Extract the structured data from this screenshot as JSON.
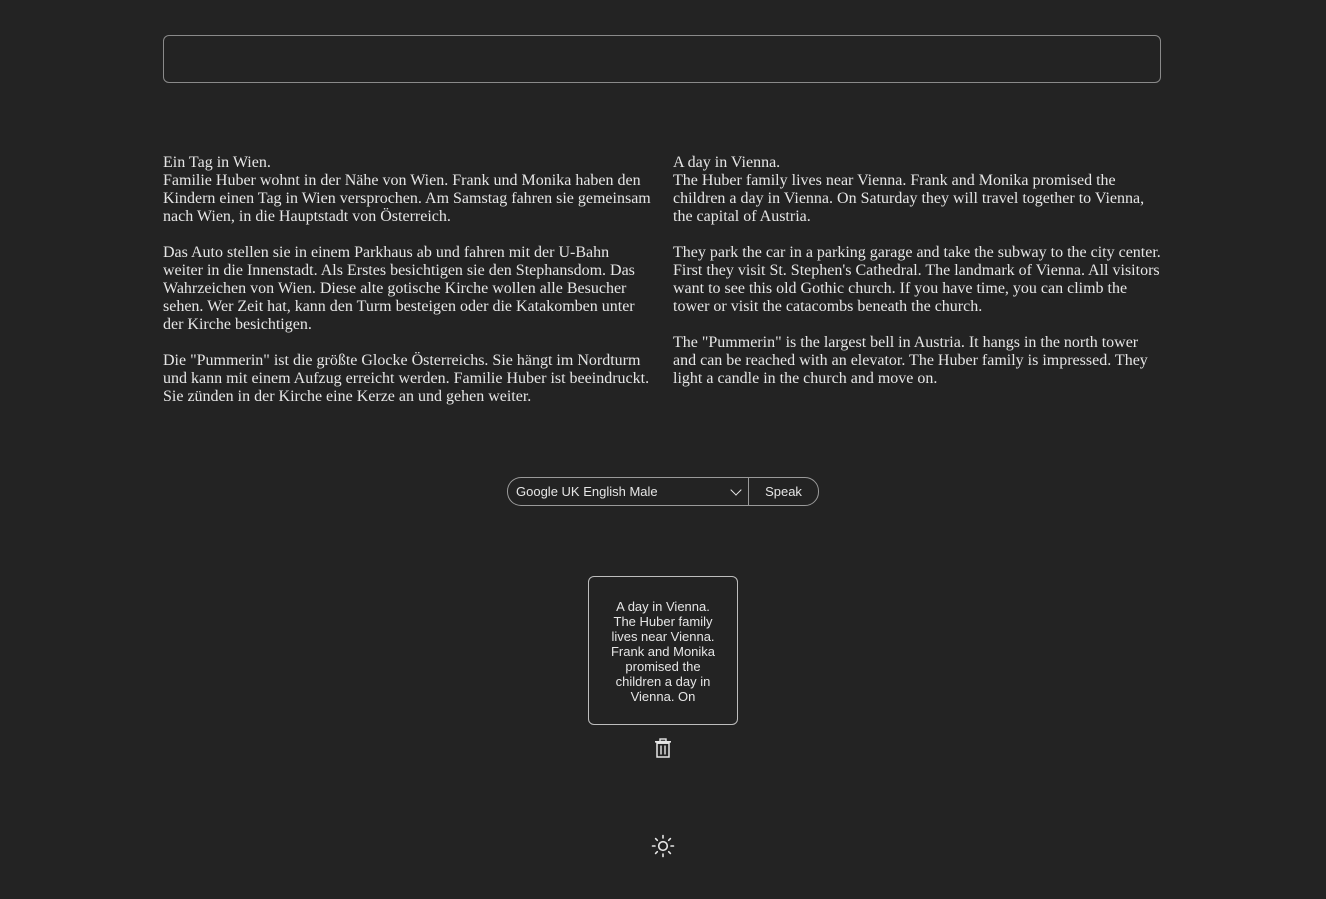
{
  "search": {
    "placeholder": "",
    "value": ""
  },
  "german": {
    "title": "Ein Tag in Wien.",
    "paragraphs": [
      "Familie Huber wohnt in der Nähe von Wien. Frank und Monika haben den Kindern einen Tag in Wien versprochen. Am Samstag fahren sie gemeinsam nach Wien, in die Hauptstadt von Österreich.",
      "Das Auto stellen sie in einem Parkhaus ab und fahren mit der U-Bahn weiter in die Innenstadt. Als Erstes besichtigen sie den Stephansdom. Das Wahrzeichen von Wien. Diese alte gotische Kirche wollen alle Besucher sehen. Wer Zeit hat, kann den Turm besteigen oder die Katakomben unter der Kirche besichtigen.",
      "Die \"Pummerin\" ist die größte Glocke Österreichs. Sie hängt im Nordturm und kann mit einem Aufzug erreicht werden. Familie Huber ist beeindruckt. Sie zünden in der Kirche eine Kerze an und gehen weiter."
    ]
  },
  "english": {
    "title": "A day in Vienna.",
    "paragraphs": [
      "The Huber family lives near Vienna. Frank and Monika promised the children a day in Vienna. On Saturday they will travel together to Vienna, the capital of Austria.",
      "They park the car in a parking garage and take the subway to the city center. First they visit St. Stephen's Cathedral. The landmark of Vienna. All visitors want to see this old Gothic church. If you have time, you can climb the tower or visit the catacombs beneath the church.",
      "The \"Pummerin\" is the largest bell in Austria. It hangs in the north tower and can be reached with an elevator. The Huber family is impressed. They light a candle in the church and move on."
    ]
  },
  "controls": {
    "voice_selected": "Google UK English Male",
    "speak_label": "Speak"
  },
  "card": {
    "text": "A day in Vienna. The Huber family lives near Vienna. Frank and Monika promised the children a day in Vienna. On"
  },
  "icons": {
    "delete": "trash-icon",
    "theme": "sun-icon"
  }
}
